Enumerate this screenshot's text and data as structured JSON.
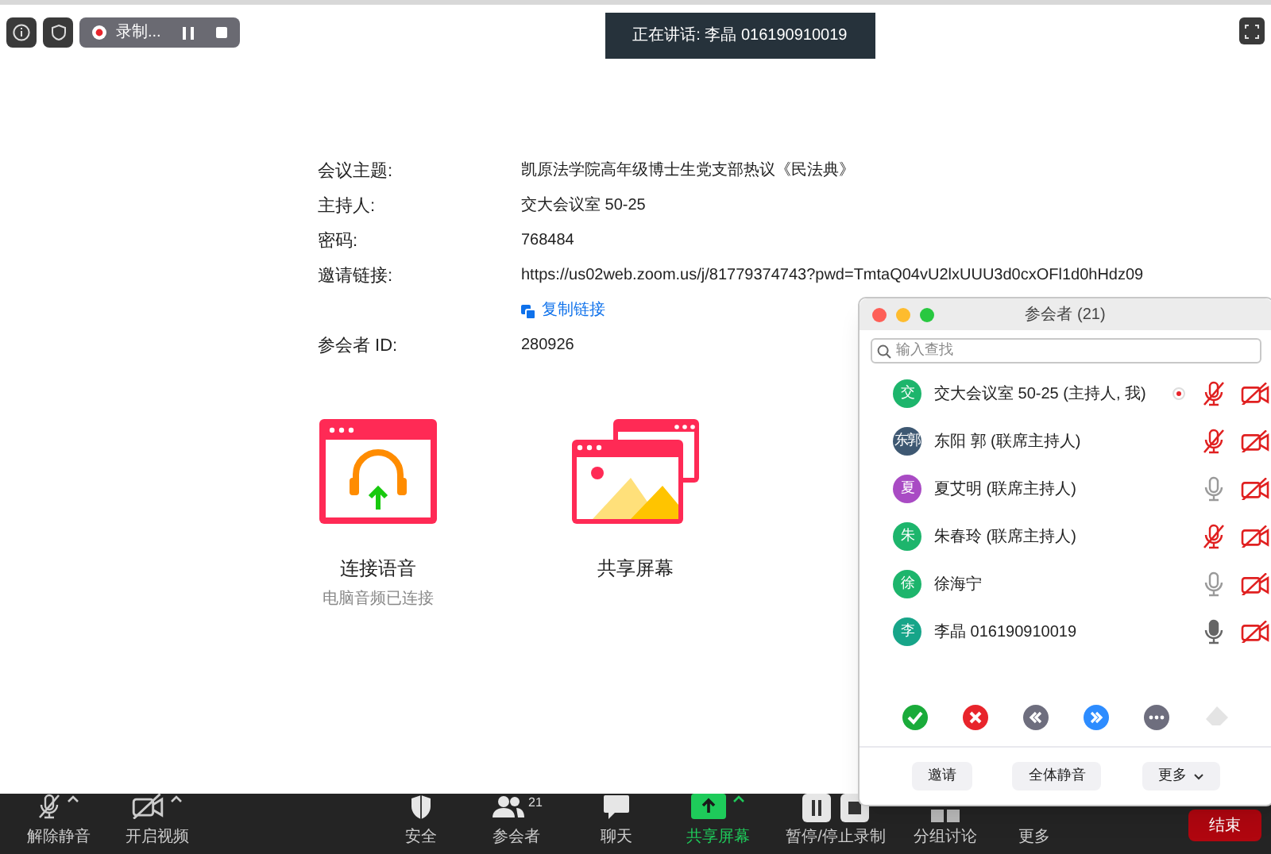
{
  "top_bar": {
    "recording": {
      "label": "录制..."
    },
    "speaking_banner": "正在讲话: 李晶 016190910019"
  },
  "meeting_info": [
    {
      "label": "会议主题:",
      "value": "凯原法学院高年级博士生党支部热议《民法典》"
    },
    {
      "label": "主持人:",
      "value": "交大会议室 50-25"
    },
    {
      "label": "密码:",
      "value": "768484"
    },
    {
      "label": "邀请链接:",
      "value": "https://us02web.zoom.us/j/81779374743?pwd=TmtaQ04vU2lxUUU3d0cxOFl1d0hHdz09"
    },
    {
      "label": "参会者 ID:",
      "value": "280926"
    }
  ],
  "copy_link": "复制链接",
  "actions": [
    {
      "kind": "audio",
      "label": "连接语音",
      "sublabel": "电脑音频已连接"
    },
    {
      "kind": "share",
      "label": "共享屏幕"
    }
  ],
  "participants_panel": {
    "title": "参会者 (21)",
    "search": {
      "placeholder": "输入查找"
    },
    "participants": [
      {
        "avatar": "交",
        "name": "交大会议室 50-25 (主持人, 我)",
        "color": "#1db56c",
        "muted": true,
        "recording": true
      },
      {
        "avatar": "东郭",
        "name": "东阳 郭 (联席主持人)",
        "color": "#3e5872",
        "muted": true,
        "recording": false
      },
      {
        "avatar": "夏",
        "name": "夏艾明 (联席主持人)",
        "color": "#a94bc4",
        "muted": false,
        "speaking": false,
        "recording": false
      },
      {
        "avatar": "朱",
        "name": "朱春玲 (联席主持人)",
        "color": "#1db56c",
        "muted": true,
        "recording": false
      },
      {
        "avatar": "徐",
        "name": "徐海宁",
        "color": "#1db56c",
        "muted": false,
        "speaking": false,
        "recording": false
      },
      {
        "avatar": "李",
        "name": "李晶 016190910019",
        "color": "#17a589",
        "muted": false,
        "speaking": true,
        "recording": false
      }
    ],
    "reactions": [
      {
        "kind": "yes"
      },
      {
        "kind": "no"
      },
      {
        "kind": "slower"
      },
      {
        "kind": "faster"
      },
      {
        "kind": "more"
      },
      {
        "kind": "clear"
      }
    ],
    "buttons": [
      "邀请",
      "全体静音",
      "更多"
    ]
  },
  "toolbar": [
    {
      "kind": "mic",
      "label": "解除静音"
    },
    {
      "kind": "video",
      "label": "开启视频"
    },
    {
      "kind": "security",
      "label": "安全"
    },
    {
      "kind": "participants",
      "label": "参会者",
      "count": "21"
    },
    {
      "kind": "chat",
      "label": "聊天"
    },
    {
      "kind": "share",
      "label": "共享屏幕"
    },
    {
      "kind": "record",
      "label": "暂停/停止录制"
    },
    {
      "kind": "breakout",
      "label": "分组讨论"
    },
    {
      "kind": "more",
      "label": "更多"
    }
  ],
  "end_button": "结束"
}
